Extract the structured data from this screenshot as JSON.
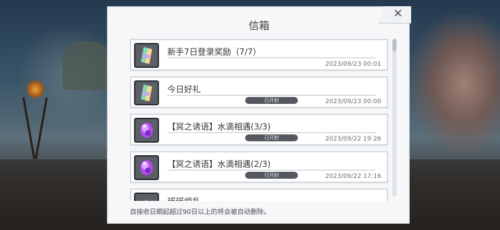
{
  "dialog": {
    "title": "信箱",
    "close_label": "✕",
    "footer_note": "自接收日期起超过90日以上的将会被自动删除。"
  },
  "mails": [
    {
      "title": "新手7日登录奖励（7/7）",
      "date": "2023/09/23 00:01",
      "status": "",
      "icon": "prism-crystal-icon"
    },
    {
      "title": "今日好礼",
      "date": "2023/09/23 00:00",
      "status": "已开封",
      "icon": "prism-crystal-icon"
    },
    {
      "title": "【冥之诱语】水滴相遇(3/3)",
      "date": "2023/09/22 19:26",
      "status": "已开封",
      "icon": "purple-gem-icon"
    },
    {
      "title": "【冥之诱语】水滴相遇(2/3)",
      "date": "2023/09/22 17:16",
      "status": "已开封",
      "icon": "purple-gem-icon"
    },
    {
      "title": "瑶瑶烦乱",
      "date": "",
      "status": "",
      "icon": "dark-item-icon"
    }
  ]
}
